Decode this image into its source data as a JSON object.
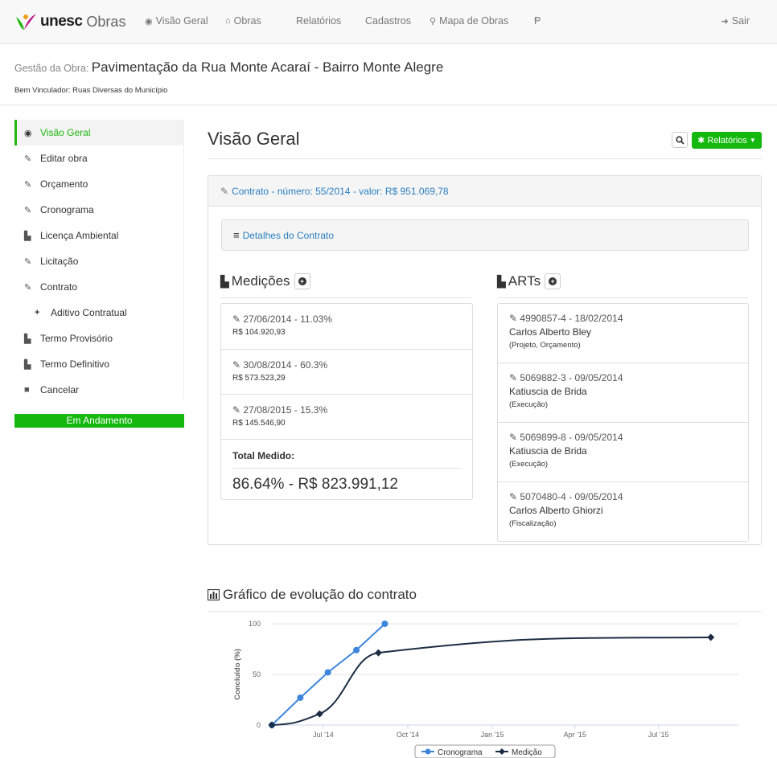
{
  "navbar": {
    "brand_main": "unesc",
    "brand_suffix": "Obras",
    "items": [
      {
        "icon": "dashboard-icon",
        "label": "Visão Geral"
      },
      {
        "icon": "home-icon",
        "label": "Obras"
      },
      {
        "icon": "",
        "label": "Relatórios"
      },
      {
        "icon": "",
        "label": "Cadastros"
      },
      {
        "icon": "map-marker-icon",
        "label": "Mapa de Obras"
      },
      {
        "icon": "",
        "label": "Ᵽ"
      }
    ],
    "exit_label": "Sair"
  },
  "header": {
    "obra_label": "Gestão da Obra:",
    "obra_name": "Pavimentação da Rua Monte Acaraí - Bairro Monte Alegre",
    "bem_vinculado": "Bem Vinculador: Ruas Diversas do Município"
  },
  "sidebar": {
    "items": [
      {
        "label": "Visão Geral",
        "icon": "dashboard-icon",
        "active": true
      },
      {
        "label": "Editar obra",
        "icon": "edit-icon"
      },
      {
        "label": "Orçamento",
        "icon": "edit-icon"
      },
      {
        "label": "Cronograma",
        "icon": "edit-icon"
      },
      {
        "label": "Licença Ambiental",
        "icon": "file-icon"
      },
      {
        "label": "Licitação",
        "icon": "edit-icon"
      },
      {
        "label": "Contrato",
        "icon": "edit-icon"
      },
      {
        "label": "Aditivo Contratual",
        "icon": "plus-icon",
        "sub": true
      },
      {
        "label": "Termo Provisório",
        "icon": "file-icon"
      },
      {
        "label": "Termo Definitivo",
        "icon": "file-icon"
      },
      {
        "label": "Cancelar",
        "icon": "stop-icon"
      }
    ],
    "status": "Em Andamento"
  },
  "main": {
    "title": "Visão Geral",
    "reports_button": "Relatórios",
    "contract_header": "Contrato - número: 55/2014 - valor: R$ 951.069,78",
    "details_link": "Detalhes do Contrato",
    "medicoes": {
      "title": "Medições",
      "items": [
        {
          "title": "27/06/2014 - 11.03%",
          "value": "R$ 104.920,93"
        },
        {
          "title": "30/08/2014 - 60.3%",
          "value": "R$ 573.523,29"
        },
        {
          "title": "27/08/2015 - 15.3%",
          "value": "R$ 145.546,90"
        }
      ],
      "total_label": "Total Medido:",
      "total_value": "86.64% - R$ 823.991,12"
    },
    "arts": {
      "title": "ARTs",
      "items": [
        {
          "title": "4990857-4 - 18/02/2014",
          "name": "Carlos Alberto Bley",
          "role": "(Projeto, Orçamento)"
        },
        {
          "title": "5069882-3 - 09/05/2014",
          "name": "Katiuscia de Brida",
          "role": "(Execução)"
        },
        {
          "title": "5069899-8 - 09/05/2014",
          "name": "Katiuscia de Brida",
          "role": "(Execução)"
        },
        {
          "title": "5070480-4 - 09/05/2014",
          "name": "Carlos Alberto Ghiorzi",
          "role": "(Fiscalização)"
        }
      ]
    },
    "chart_title": "Gráfico de evolução do contrato"
  },
  "colors": {
    "brand_green": "#14b80e",
    "link_blue": "#2a7fc1",
    "series_cronograma": "#3d86dc",
    "series_medicao": "#1d2d44"
  },
  "chart_data": {
    "type": "line",
    "ylabel": "Concluído (%)",
    "xlabel": "",
    "ylim": [
      0,
      100
    ],
    "yticks": [
      0,
      50,
      100
    ],
    "x_ticks": [
      {
        "date": "2014-07-01",
        "label": "Jul '14"
      },
      {
        "date": "2014-10-01",
        "label": "Oct '14"
      },
      {
        "date": "2015-01-01",
        "label": "Jan '15"
      },
      {
        "date": "2015-04-01",
        "label": "Apr '15"
      },
      {
        "date": "2015-07-01",
        "label": "Jul '15"
      }
    ],
    "xlim": [
      "2014-05-06",
      "2015-09-26"
    ],
    "legend_position": "bottom-center",
    "grid": true,
    "series": [
      {
        "name": "Cronograma",
        "points": [
          {
            "x": "2014-05-06",
            "y": 0
          },
          {
            "x": "2014-06-06",
            "y": 27
          },
          {
            "x": "2014-07-06",
            "y": 52
          },
          {
            "x": "2014-08-06",
            "y": 74
          },
          {
            "x": "2014-09-06",
            "y": 100
          }
        ]
      },
      {
        "name": "Medição",
        "points": [
          {
            "x": "2014-05-06",
            "y": 0
          },
          {
            "x": "2014-06-27",
            "y": 11.03
          },
          {
            "x": "2014-08-30",
            "y": 71.33
          },
          {
            "x": "2015-08-27",
            "y": 86.64
          }
        ]
      }
    ]
  }
}
